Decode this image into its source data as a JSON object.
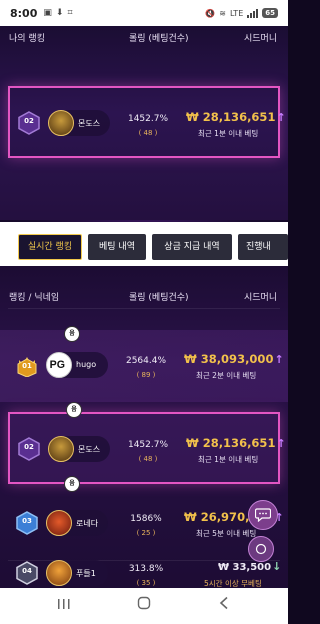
{
  "status_bar": {
    "time": "8:00",
    "battery": "65"
  },
  "my_ranking": {
    "header": {
      "col_rank": "나의 랭킹",
      "col_rolling": "롤링 (베팅건수)",
      "col_seamless": "시드머니"
    },
    "row": {
      "rank": "02",
      "nickname": "몬도스",
      "rolling_pct": "1452.7%",
      "bet_count": "( 48 )",
      "amount": "₩ 28,136,651",
      "time": "최근 1분 이내 베팅"
    }
  },
  "tabs": [
    {
      "label": "실시간 랭킹",
      "active": true
    },
    {
      "label": "베팅 내역",
      "active": false
    },
    {
      "label": "상금 지급 내역",
      "active": false
    },
    {
      "label": "진행내",
      "active": false
    }
  ],
  "live_ranking": {
    "header": {
      "col_rank": "랭킹 / 닉네임",
      "col_rolling": "롤링 (베팅건수)",
      "col_seamless": "시드머니"
    },
    "rows": [
      {
        "rank": "01",
        "nickname": "hugo",
        "badge": "음",
        "rolling_pct": "2564.4%",
        "bet_count": "( 89 )",
        "amount": "₩ 38,093,000",
        "trend": "up",
        "time": "최근 2분 이내 베팅"
      },
      {
        "rank": "02",
        "nickname": "몬도스",
        "badge": "음",
        "rolling_pct": "1452.7%",
        "bet_count": "( 48 )",
        "amount": "₩ 28,136,651",
        "trend": "up",
        "time": "최근 1분 이내 베팅"
      },
      {
        "rank": "03",
        "nickname": "로네다",
        "badge": "음",
        "rolling_pct": "1586%",
        "bet_count": "( 25 )",
        "amount": "₩ 26,970,000",
        "trend": "up",
        "time": "최근 5분 이내 베팅"
      },
      {
        "rank": "04",
        "nickname": "푸들1",
        "badge": "",
        "rolling_pct": "313.8%",
        "bet_count": "( 35 )",
        "amount": "₩ 33,500",
        "trend": "down",
        "time": "5시간 이상 무베팅"
      }
    ]
  },
  "colors": {
    "accent_gold": "#f2c14b",
    "highlight_border": "#e356c3",
    "up_arrow": "#c77dff"
  },
  "icons": {
    "chat": "chat-bubble-icon",
    "home_button": "home-circle-icon",
    "nav_recent": "recent-apps-icon",
    "nav_home": "home-icon",
    "nav_back": "back-icon"
  }
}
